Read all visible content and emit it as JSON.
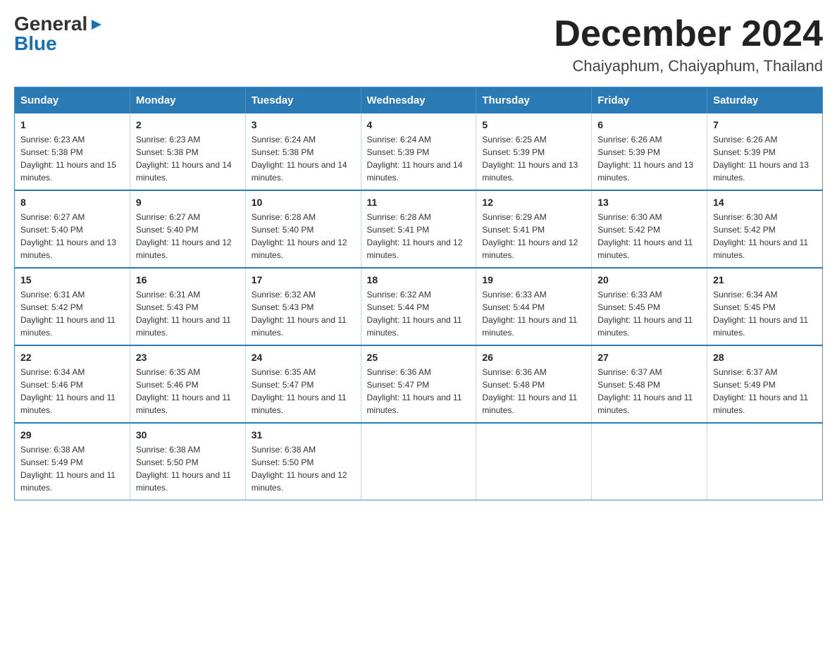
{
  "logo": {
    "general": "General",
    "blue": "Blue",
    "triangle": "▶"
  },
  "header": {
    "month_year": "December 2024",
    "location": "Chaiyaphum, Chaiyaphum, Thailand"
  },
  "days_of_week": [
    "Sunday",
    "Monday",
    "Tuesday",
    "Wednesday",
    "Thursday",
    "Friday",
    "Saturday"
  ],
  "weeks": [
    [
      {
        "day": "1",
        "sunrise": "6:23 AM",
        "sunset": "5:38 PM",
        "daylight": "11 hours and 15 minutes."
      },
      {
        "day": "2",
        "sunrise": "6:23 AM",
        "sunset": "5:38 PM",
        "daylight": "11 hours and 14 minutes."
      },
      {
        "day": "3",
        "sunrise": "6:24 AM",
        "sunset": "5:38 PM",
        "daylight": "11 hours and 14 minutes."
      },
      {
        "day": "4",
        "sunrise": "6:24 AM",
        "sunset": "5:39 PM",
        "daylight": "11 hours and 14 minutes."
      },
      {
        "day": "5",
        "sunrise": "6:25 AM",
        "sunset": "5:39 PM",
        "daylight": "11 hours and 13 minutes."
      },
      {
        "day": "6",
        "sunrise": "6:26 AM",
        "sunset": "5:39 PM",
        "daylight": "11 hours and 13 minutes."
      },
      {
        "day": "7",
        "sunrise": "6:26 AM",
        "sunset": "5:39 PM",
        "daylight": "11 hours and 13 minutes."
      }
    ],
    [
      {
        "day": "8",
        "sunrise": "6:27 AM",
        "sunset": "5:40 PM",
        "daylight": "11 hours and 13 minutes."
      },
      {
        "day": "9",
        "sunrise": "6:27 AM",
        "sunset": "5:40 PM",
        "daylight": "11 hours and 12 minutes."
      },
      {
        "day": "10",
        "sunrise": "6:28 AM",
        "sunset": "5:40 PM",
        "daylight": "11 hours and 12 minutes."
      },
      {
        "day": "11",
        "sunrise": "6:28 AM",
        "sunset": "5:41 PM",
        "daylight": "11 hours and 12 minutes."
      },
      {
        "day": "12",
        "sunrise": "6:29 AM",
        "sunset": "5:41 PM",
        "daylight": "11 hours and 12 minutes."
      },
      {
        "day": "13",
        "sunrise": "6:30 AM",
        "sunset": "5:42 PM",
        "daylight": "11 hours and 11 minutes."
      },
      {
        "day": "14",
        "sunrise": "6:30 AM",
        "sunset": "5:42 PM",
        "daylight": "11 hours and 11 minutes."
      }
    ],
    [
      {
        "day": "15",
        "sunrise": "6:31 AM",
        "sunset": "5:42 PM",
        "daylight": "11 hours and 11 minutes."
      },
      {
        "day": "16",
        "sunrise": "6:31 AM",
        "sunset": "5:43 PM",
        "daylight": "11 hours and 11 minutes."
      },
      {
        "day": "17",
        "sunrise": "6:32 AM",
        "sunset": "5:43 PM",
        "daylight": "11 hours and 11 minutes."
      },
      {
        "day": "18",
        "sunrise": "6:32 AM",
        "sunset": "5:44 PM",
        "daylight": "11 hours and 11 minutes."
      },
      {
        "day": "19",
        "sunrise": "6:33 AM",
        "sunset": "5:44 PM",
        "daylight": "11 hours and 11 minutes."
      },
      {
        "day": "20",
        "sunrise": "6:33 AM",
        "sunset": "5:45 PM",
        "daylight": "11 hours and 11 minutes."
      },
      {
        "day": "21",
        "sunrise": "6:34 AM",
        "sunset": "5:45 PM",
        "daylight": "11 hours and 11 minutes."
      }
    ],
    [
      {
        "day": "22",
        "sunrise": "6:34 AM",
        "sunset": "5:46 PM",
        "daylight": "11 hours and 11 minutes."
      },
      {
        "day": "23",
        "sunrise": "6:35 AM",
        "sunset": "5:46 PM",
        "daylight": "11 hours and 11 minutes."
      },
      {
        "day": "24",
        "sunrise": "6:35 AM",
        "sunset": "5:47 PM",
        "daylight": "11 hours and 11 minutes."
      },
      {
        "day": "25",
        "sunrise": "6:36 AM",
        "sunset": "5:47 PM",
        "daylight": "11 hours and 11 minutes."
      },
      {
        "day": "26",
        "sunrise": "6:36 AM",
        "sunset": "5:48 PM",
        "daylight": "11 hours and 11 minutes."
      },
      {
        "day": "27",
        "sunrise": "6:37 AM",
        "sunset": "5:48 PM",
        "daylight": "11 hours and 11 minutes."
      },
      {
        "day": "28",
        "sunrise": "6:37 AM",
        "sunset": "5:49 PM",
        "daylight": "11 hours and 11 minutes."
      }
    ],
    [
      {
        "day": "29",
        "sunrise": "6:38 AM",
        "sunset": "5:49 PM",
        "daylight": "11 hours and 11 minutes."
      },
      {
        "day": "30",
        "sunrise": "6:38 AM",
        "sunset": "5:50 PM",
        "daylight": "11 hours and 11 minutes."
      },
      {
        "day": "31",
        "sunrise": "6:38 AM",
        "sunset": "5:50 PM",
        "daylight": "11 hours and 12 minutes."
      },
      null,
      null,
      null,
      null
    ]
  ]
}
